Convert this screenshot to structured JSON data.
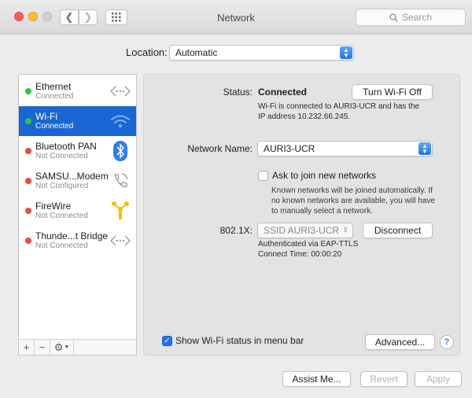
{
  "window": {
    "title": "Network",
    "search_placeholder": "Search"
  },
  "location": {
    "label": "Location:",
    "value": "Automatic"
  },
  "services": [
    {
      "name": "Ethernet",
      "status": "Connected",
      "status_color": "#28c840",
      "icon": "ethernet-icon"
    },
    {
      "name": "Wi-Fi",
      "status": "Connected",
      "status_color": "#28c840",
      "icon": "wifi-icon"
    },
    {
      "name": "Bluetooth PAN",
      "status": "Not Connected",
      "status_color": "#f2463f",
      "icon": "bluetooth-icon"
    },
    {
      "name": "SAMSU...Modem",
      "status": "Not Configured",
      "status_color": "#f2463f",
      "icon": "phone-icon"
    },
    {
      "name": "FireWire",
      "status": "Not Connected",
      "status_color": "#f2463f",
      "icon": "firewire-icon"
    },
    {
      "name": "Thunde...t Bridge",
      "status": "Not Connected",
      "status_color": "#f2463f",
      "icon": "thunderbolt-bridge-icon"
    }
  ],
  "sidebar_controls": {
    "add": "+",
    "remove": "−",
    "gear": "⚙"
  },
  "wifi": {
    "status_label": "Status:",
    "status_value": "Connected",
    "turn_off_button": "Turn Wi-Fi Off",
    "status_detail_1": "Wi-Fi is connected to AURI3-UCR and has the",
    "status_detail_2": "IP address 10.232.66.245.",
    "network_name_label": "Network Name:",
    "network_name_value": "AURI3-UCR",
    "ask_join_label": "Ask to join new networks",
    "ask_join_checked": false,
    "ask_join_help_1": "Known networks will be joined automatically. If",
    "ask_join_help_2": "no known networks are available, you will have",
    "ask_join_help_3": "to manually select a network.",
    "dot1x_label": "802.1X:",
    "dot1x_value": "SSID AURI3-UCR",
    "disconnect_button": "Disconnect",
    "auth_line": "Authenticated via EAP-TTLS",
    "connect_time": "Connect Time: 00:00:20",
    "show_status_label": "Show Wi-Fi status in menu bar",
    "show_status_checked": true,
    "advanced_button": "Advanced...",
    "help_button": "?"
  },
  "footer": {
    "assist": "Assist Me...",
    "revert": "Revert",
    "apply": "Apply"
  },
  "colors": {
    "accent": "#1a66d3",
    "connected": "#28c840",
    "disconnected": "#f2463f"
  }
}
